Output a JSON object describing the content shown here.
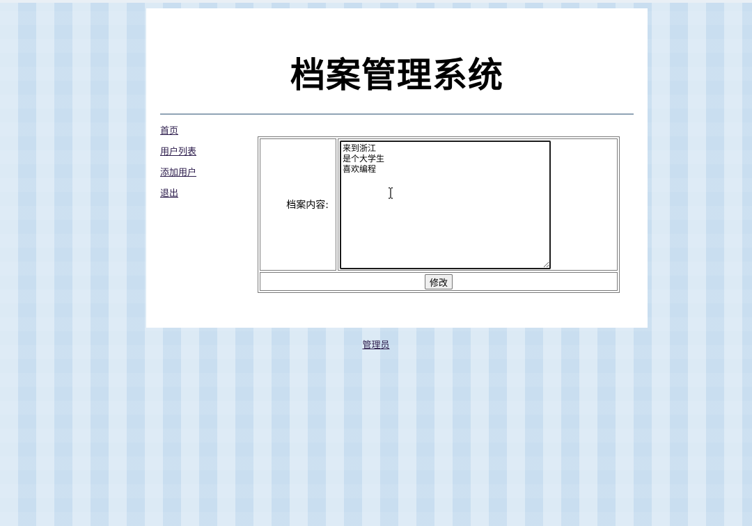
{
  "app": {
    "title": "档案管理系统"
  },
  "nav": {
    "items": [
      {
        "label": "首页"
      },
      {
        "label": "用户列表"
      },
      {
        "label": "添加用户"
      },
      {
        "label": "退出"
      }
    ]
  },
  "form": {
    "content_label": "档案内容:",
    "content_value": "来到浙江\n是个大学生\n喜欢编程",
    "submit_label": "修改"
  },
  "footer": {
    "link_label": "管理员"
  },
  "colors": {
    "background": "#c9def0",
    "panel": "#ffffff",
    "divider": "#8fa3b5",
    "link": "#2a1a4a"
  },
  "icons": {
    "pointer": "text-cursor-icon"
  }
}
